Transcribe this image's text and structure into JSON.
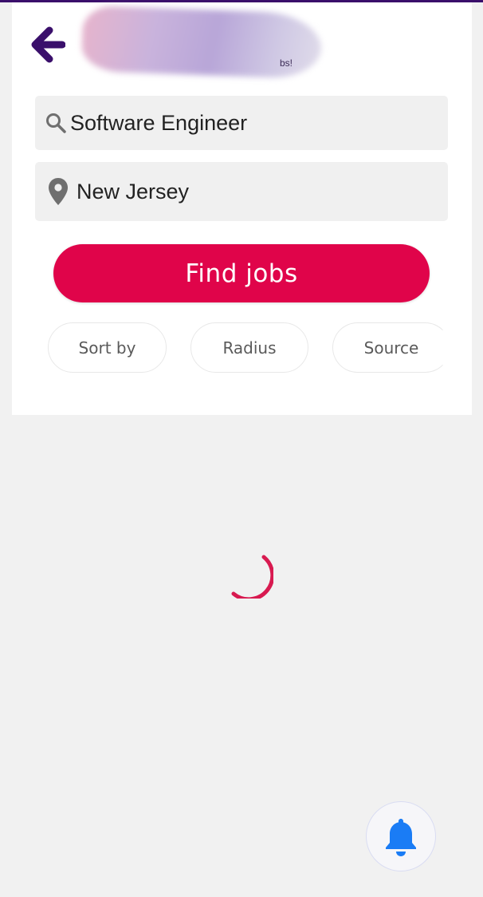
{
  "header": {
    "back_icon": "arrow-left-icon",
    "brand_tagline_fragment": "bs!",
    "brand_color": "#3a0f6b"
  },
  "search": {
    "what_icon": "search-icon",
    "what_value": "Software Engineer",
    "where_icon": "location-pin-icon",
    "where_value": "New Jersey"
  },
  "find_button": {
    "label": "Find jobs",
    "color": "#e0044a"
  },
  "filters": [
    {
      "label": "Sort by"
    },
    {
      "label": "Radius"
    },
    {
      "label": "Source"
    }
  ],
  "status": {
    "loading_icon": "spinner-icon",
    "spinner_color": "#d81a50"
  },
  "alerts_button": {
    "icon": "bell-icon",
    "color": "#1a7cf5"
  }
}
